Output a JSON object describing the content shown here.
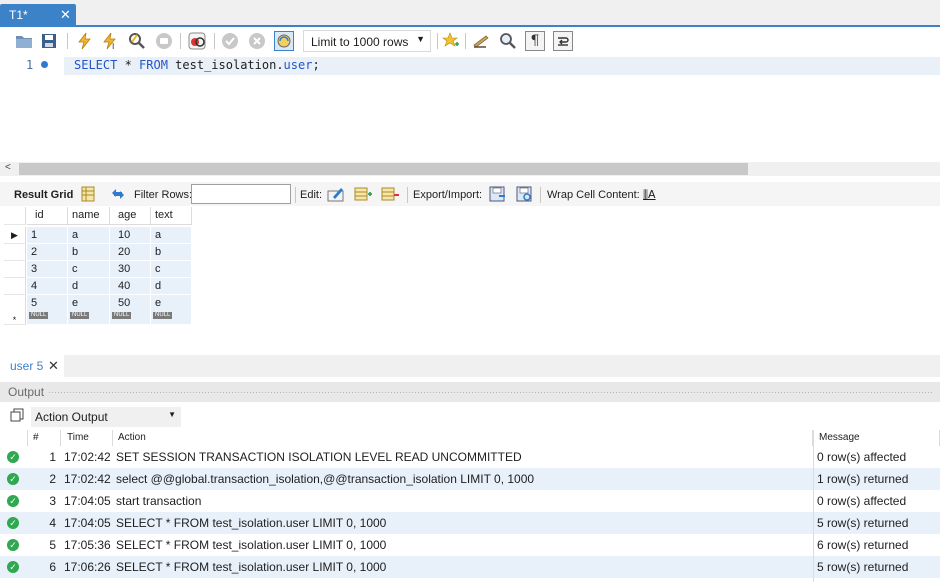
{
  "editor_tab": {
    "label": "T1*",
    "close": "✕"
  },
  "toolbar": {
    "limit_value": "Limit to 1000 rows",
    "icons": [
      "open-folder-icon",
      "save-icon",
      "execute-icon",
      "execute-current-icon",
      "explain-icon",
      "stop-icon",
      "toggle-error-icon",
      "commit-icon",
      "rollback-icon",
      "autocommit-icon",
      "bookmark-star-icon",
      "beautify-icon",
      "find-icon",
      "invisible-chars-icon",
      "wrap-icon"
    ]
  },
  "editor": {
    "line_number": "1",
    "sql": {
      "kw1": "SELECT",
      "star": " * ",
      "kw2": "FROM",
      "schema": " test_isolation.",
      "table": "user",
      "end": ";"
    }
  },
  "result_toolbar": {
    "result_grid": "Result Grid",
    "filter_rows": "Filter Rows:",
    "filter_value": "",
    "edit": "Edit:",
    "export_import": "Export/Import:",
    "wrap_cell": "Wrap Cell Content:"
  },
  "grid": {
    "columns": [
      "id",
      "name",
      "age",
      "text"
    ],
    "rows": [
      [
        "1",
        "a",
        "10",
        "a"
      ],
      [
        "2",
        "b",
        "20",
        "b"
      ],
      [
        "3",
        "c",
        "30",
        "c"
      ],
      [
        "4",
        "d",
        "40",
        "d"
      ],
      [
        "5",
        "e",
        "50",
        "e"
      ]
    ],
    "null_label": "NULL",
    "new_row_marker": "*",
    "current_row_marker": "▶"
  },
  "result_tab": {
    "label": "user 5",
    "close": "✕"
  },
  "output": {
    "title": "Output",
    "selector": "Action Output",
    "headers": {
      "num": "#",
      "time": "Time",
      "action": "Action",
      "message": "Message"
    },
    "rows": [
      {
        "num": "1",
        "time": "17:02:42",
        "action": "SET SESSION TRANSACTION ISOLATION LEVEL READ UNCOMMITTED",
        "message": "0 row(s) affected"
      },
      {
        "num": "2",
        "time": "17:02:42",
        "action": "select @@global.transaction_isolation,@@transaction_isolation LIMIT 0, 1000",
        "message": "1 row(s) returned"
      },
      {
        "num": "3",
        "time": "17:04:05",
        "action": "start transaction",
        "message": "0 row(s) affected"
      },
      {
        "num": "4",
        "time": "17:04:05",
        "action": "SELECT * FROM test_isolation.user LIMIT 0, 1000",
        "message": "5 row(s) returned"
      },
      {
        "num": "5",
        "time": "17:05:36",
        "action": "SELECT * FROM test_isolation.user LIMIT 0, 1000",
        "message": "6 row(s) returned"
      },
      {
        "num": "6",
        "time": "17:06:26",
        "action": "SELECT * FROM test_isolation.user LIMIT 0, 1000",
        "message": "5 row(s) returned"
      }
    ],
    "status_icon": "success-check-icon"
  },
  "colors": {
    "accent": "#3c82c8",
    "row_band": "#e8f0fa",
    "ok": "#2fa84f",
    "keyword": "#2255cc"
  }
}
